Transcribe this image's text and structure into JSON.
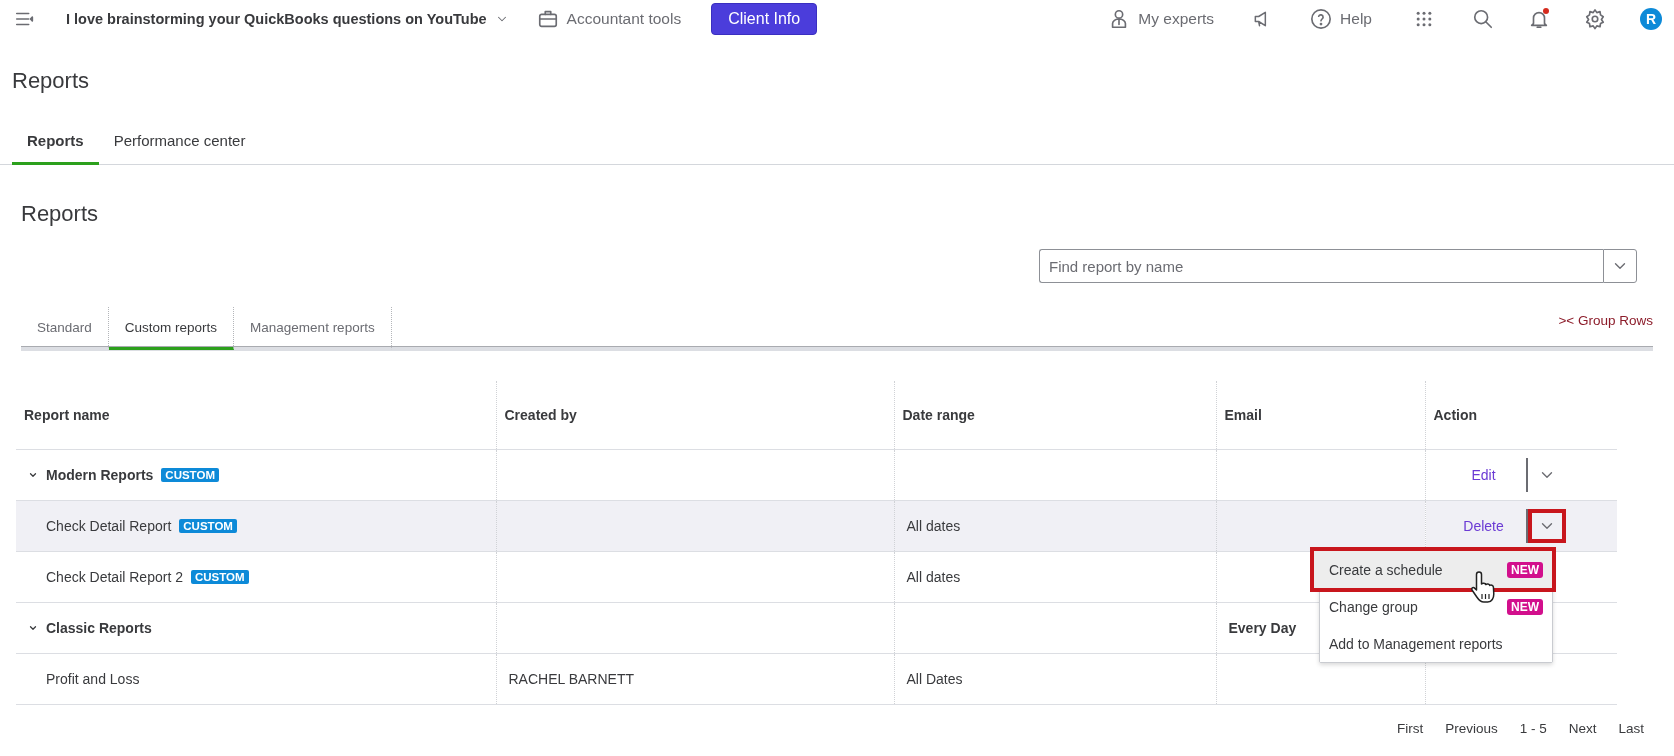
{
  "topbar": {
    "company": "I love brainstorming your QuickBooks questions on YouTube",
    "accountant_tools": "Accountant tools",
    "client_info": "Client Info",
    "my_experts": "My experts",
    "help": "Help",
    "avatar": "R",
    "notification_dot": true
  },
  "page_title": "Reports",
  "page_tabs": [
    {
      "label": "Reports",
      "selected": true
    },
    {
      "label": "Performance center",
      "selected": false
    }
  ],
  "section_title": "Reports",
  "search": {
    "placeholder": "Find report by name"
  },
  "report_tabs": [
    {
      "label": "Standard",
      "selected": false
    },
    {
      "label": "Custom reports",
      "selected": true
    },
    {
      "label": "Management reports",
      "selected": false
    }
  ],
  "group_rows": ">< Group Rows",
  "table": {
    "columns": [
      "Report name",
      "Created by",
      "Date range",
      "Email",
      "Action"
    ],
    "rows": [
      {
        "kind": "group",
        "name": "Modern Reports",
        "badge": "CUSTOM",
        "expanded": true,
        "created_by": "",
        "date_range": "",
        "email": "",
        "action": "Edit",
        "highlighted": false,
        "menu_open": false
      },
      {
        "kind": "report",
        "name": "Check Detail Report",
        "badge": "CUSTOM",
        "created_by": "",
        "date_range": "All dates",
        "email": "",
        "action": "Delete",
        "highlighted": true,
        "menu_open": true
      },
      {
        "kind": "report",
        "name": "Check Detail Report 2",
        "badge": "CUSTOM",
        "created_by": "",
        "date_range": "All dates",
        "email": "",
        "highlighted": false,
        "menu_open": false
      },
      {
        "kind": "group",
        "name": "Classic Reports",
        "expanded": true,
        "created_by": "",
        "date_range": "",
        "email": "Every Day",
        "highlighted": false,
        "menu_open": false
      },
      {
        "kind": "report",
        "name": "Profit and Loss",
        "created_by": "RACHEL BARNETT",
        "date_range": "All Dates",
        "email": "",
        "highlighted": false,
        "menu_open": false
      }
    ]
  },
  "action_menu": [
    {
      "label": "Create a schedule",
      "badge": "NEW",
      "highlighted": true
    },
    {
      "label": "Change group",
      "badge": "NEW",
      "highlighted": false
    },
    {
      "label": "Add to Management reports",
      "highlighted": false
    }
  ],
  "pagination": [
    "First",
    "Previous",
    "1 - 5",
    "Next",
    "Last"
  ]
}
